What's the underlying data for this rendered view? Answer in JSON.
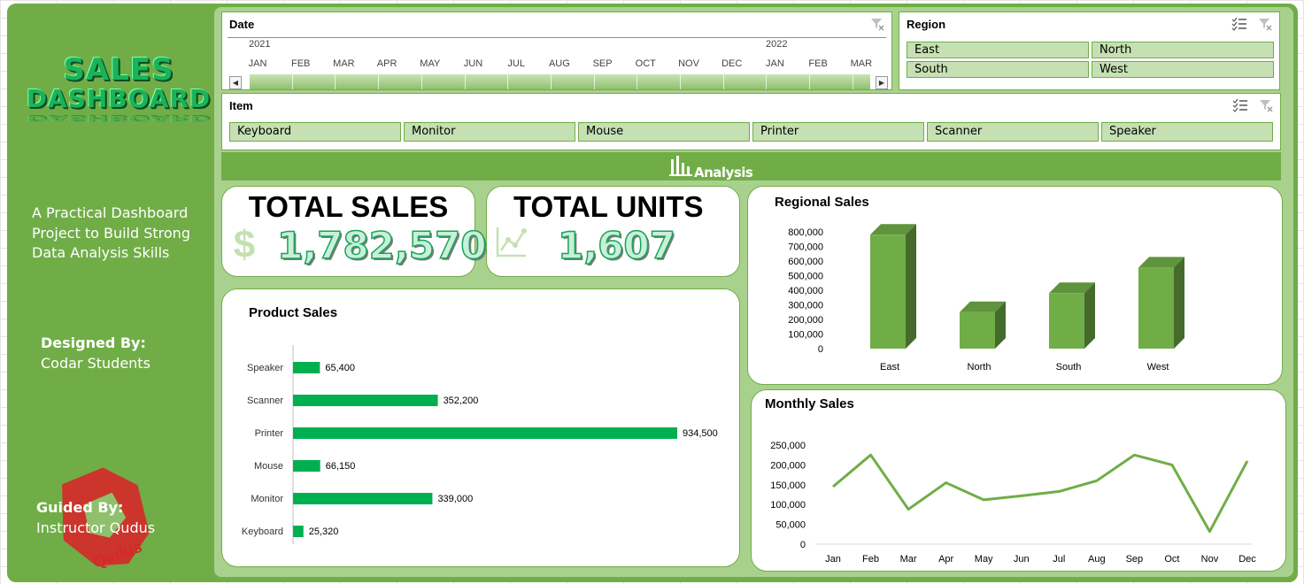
{
  "sidebar": {
    "logo_line1": "SALES",
    "logo_line2": "DASHBOARD",
    "tagline": "A Practical Dashboard Project to Build Strong Data Analysis Skills",
    "designed_label": "Designed By:",
    "designed_value": "Codar Students",
    "guided_label": "Guided By:",
    "guided_value": "Instructor Qudus",
    "stamp_text": "Qudus"
  },
  "date_slicer": {
    "title": "Date",
    "years": [
      "2021",
      "2022"
    ],
    "months": [
      "JAN",
      "FEB",
      "MAR",
      "APR",
      "MAY",
      "JUN",
      "JUL",
      "AUG",
      "SEP",
      "OCT",
      "NOV",
      "DEC",
      "JAN",
      "FEB",
      "MAR"
    ]
  },
  "region_slicer": {
    "title": "Region",
    "items": [
      "East",
      "North",
      "South",
      "West"
    ]
  },
  "item_slicer": {
    "title": "Item",
    "items": [
      "Keyboard",
      "Monitor",
      "Mouse",
      "Printer",
      "Scanner",
      "Speaker"
    ]
  },
  "analysis_label": "Analysis",
  "kpis": {
    "total_sales_title": "TOTAL SALES",
    "total_sales_value": "1,782,570",
    "total_sales_icon": "dollar-icon",
    "total_units_title": "TOTAL UNITS",
    "total_units_value": "1,607",
    "total_units_icon": "line-chart-icon"
  },
  "colors": {
    "frame": "#70ad47",
    "panel": "#a9d18e",
    "chip": "#c5e0b3",
    "bar_green": "#00b050",
    "column_green": "#70ad47",
    "line_green": "#70ad47"
  },
  "chart_data": [
    {
      "type": "bar",
      "title": "Regional Sales",
      "categories": [
        "East",
        "North",
        "South",
        "West"
      ],
      "values": [
        780000,
        250000,
        380000,
        555000
      ],
      "ylim": [
        0,
        800000
      ],
      "yticks": [
        "0",
        "100,000",
        "200,000",
        "300,000",
        "400,000",
        "500,000",
        "600,000",
        "700,000",
        "800,000"
      ],
      "grid": false
    },
    {
      "type": "bar",
      "orientation": "horizontal",
      "title": "Product Sales",
      "categories": [
        "Keyboard",
        "Monitor",
        "Mouse",
        "Printer",
        "Scanner",
        "Speaker"
      ],
      "values": [
        25320,
        339000,
        66150,
        934500,
        352200,
        65400
      ],
      "labels": [
        "25,320",
        "339,000",
        "66,150",
        "934,500",
        "352,200",
        "65,400"
      ],
      "grid": false
    },
    {
      "type": "line",
      "title": "Monthly Sales",
      "x": [
        "Jan",
        "Feb",
        "Mar",
        "Apr",
        "May",
        "Jun",
        "Jul",
        "Aug",
        "Sep",
        "Oct",
        "Nov",
        "Dec"
      ],
      "values": [
        145000,
        225000,
        88000,
        155000,
        112000,
        122000,
        133000,
        160000,
        225000,
        200000,
        32000,
        210000
      ],
      "ylim": [
        0,
        250000
      ],
      "yticks": [
        "0",
        "50,000",
        "100,000",
        "150,000",
        "200,000",
        "250,000"
      ],
      "grid": false
    }
  ]
}
